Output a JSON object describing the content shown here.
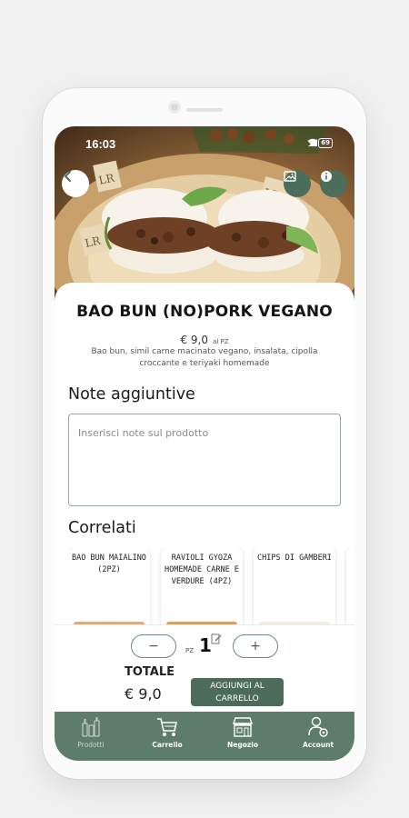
{
  "status_bar": {
    "time": "16:03",
    "battery": "69"
  },
  "product": {
    "name": "BAO BUN (NO)PORK VEGANO",
    "price": "€ 9,0",
    "price_unit": "al PZ",
    "description": "Bao bun, simil carne macinato vegano, insalata, cipolla croccante e teriyaki homemade"
  },
  "notes": {
    "title": "Note aggiuntive",
    "placeholder": "Inserisci note sul prodotto"
  },
  "related": {
    "title": "Correlati",
    "items": [
      {
        "name": "BAO BUN MAIALINO (2PZ)"
      },
      {
        "name": "RAVIOLI GYOZA HOMEMADE CARNE E VERDURE (4PZ)"
      },
      {
        "name": "CHIPS DI GAMBERI"
      }
    ]
  },
  "cart": {
    "minus": "−",
    "plus": "+",
    "qty_unit": "PZ",
    "quantity": "1",
    "total_label": "TOTALE",
    "total_value": "€ 9,0",
    "add_button": "AGGIUNGI AL CARRELLO"
  },
  "tabs": [
    {
      "label": "Prodotti",
      "icon": "bottles-icon",
      "active": true
    },
    {
      "label": "Carrello",
      "icon": "cart-icon",
      "active": false
    },
    {
      "label": "Negozio",
      "icon": "store-icon",
      "active": false
    },
    {
      "label": "Account",
      "icon": "user-settings-icon",
      "active": false
    }
  ],
  "colors": {
    "brand_green": "#4d6b59",
    "tabbar": "#5d7c69",
    "background": "#f1f1f1"
  }
}
